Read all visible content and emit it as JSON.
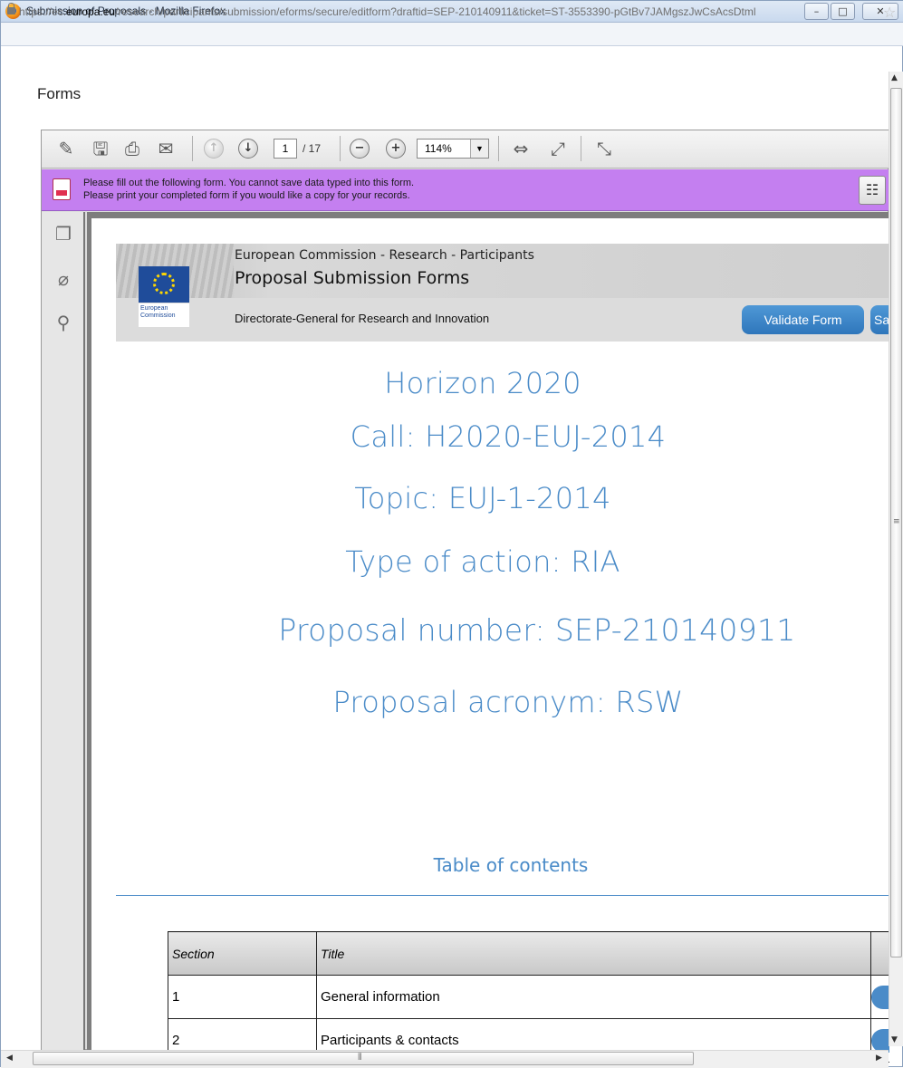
{
  "window": {
    "title": "Submission of Proposals - Mozilla Firefox",
    "minimize_label": "–",
    "maximize_label": "□",
    "close_label": "✕"
  },
  "urlbar": {
    "url_prefix": "https://ec.",
    "url_domain": "europa.eu",
    "url_rest": "/research/participants/submission/eforms/secure/editform?draftid=SEP-210140911&ticket=ST-3553390-pGtBv7JAMgszJwCsAcsDtml"
  },
  "page": {
    "label": "Forms"
  },
  "pdf_toolbar": {
    "page_current": "1",
    "page_total": "/ 17",
    "zoom": "114%",
    "icons": [
      "edit-icon",
      "save-icon",
      "print-icon",
      "email-icon",
      "prev-page-icon",
      "next-page-icon",
      "zoom-out-icon",
      "zoom-in-icon",
      "fit-width-icon",
      "fit-page-icon",
      "fullscreen-icon"
    ]
  },
  "notice": {
    "line1": "Please fill out the following form. You cannot save data typed into this form.",
    "line2": "Please print your completed form if you would like a copy for your records."
  },
  "form_header": {
    "org_line": "European Commission - Research - Participants",
    "title": "Proposal Submission Forms",
    "dg_line": "Directorate-General for Research and Innovation",
    "ec_logo_text": "European Commission",
    "validate_label": "Validate Form",
    "save_label": "Save"
  },
  "headings": {
    "programme": "Horizon 2020",
    "call": "Call: H2020-EUJ-2014",
    "topic": "Topic: EUJ-1-2014",
    "action_type": "Type of action: RIA",
    "proposal_number": "Proposal number: SEP-210140911",
    "acronym": "Proposal acronym: RSW"
  },
  "toc": {
    "title": "Table of contents",
    "columns": [
      "Section",
      "Title"
    ],
    "rows": [
      {
        "section": "1",
        "title": "General information"
      },
      {
        "section": "2",
        "title": "Participants & contacts"
      }
    ]
  },
  "colors": {
    "accent_blue": "#4a8bc8",
    "notice_purple": "#c47ff0",
    "button_blue": "#2f76bb"
  }
}
